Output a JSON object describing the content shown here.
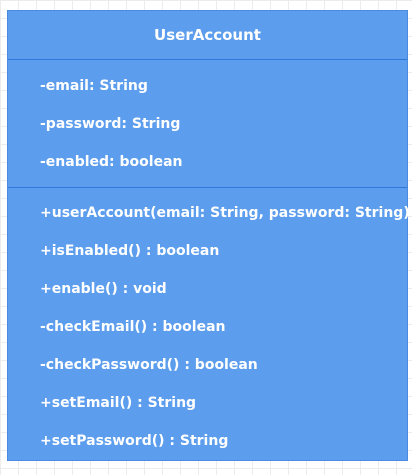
{
  "class_box": {
    "name": "UserAccount",
    "attributes": [
      "-email: String",
      "-password: String",
      "-enabled: boolean"
    ],
    "operations": [
      "+userAccount(email: String, password: String)",
      "+isEnabled() : boolean",
      "+enable() : void",
      "-checkEmail() : boolean",
      "-checkPassword() : boolean",
      "+setEmail() : String",
      "+setPassword() : String"
    ]
  },
  "colors": {
    "box_fill": "#5c9ded",
    "divider": "#2f77d8",
    "text": "#ffffff",
    "grid": "#ececec"
  }
}
